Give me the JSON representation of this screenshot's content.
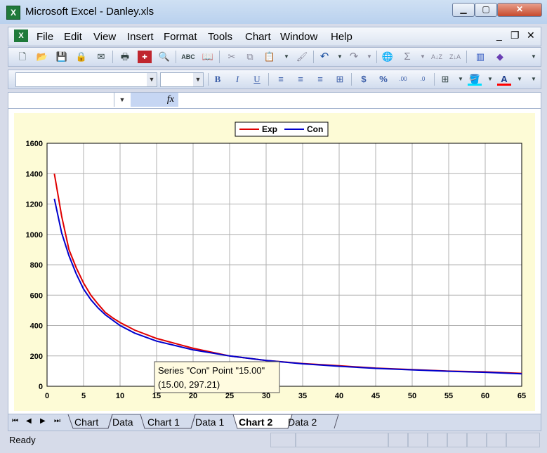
{
  "window": {
    "title": "Microsoft Excel - Danley.xls",
    "app_icon": "excel-icon"
  },
  "menu": [
    "File",
    "Edit",
    "View",
    "Insert",
    "Format",
    "Tools",
    "Chart",
    "Window",
    "Help"
  ],
  "toolbar_std": [
    "new-icon",
    "open-icon",
    "save-icon",
    "permission-icon",
    "email-icon",
    "print-icon",
    "research-icon",
    "print-preview-icon",
    "spelling-icon",
    "research-book-icon",
    "cut-icon",
    "copy-icon",
    "paste-icon",
    "format-painter-icon",
    "undo-icon",
    "redo-icon",
    "hyperlink-icon",
    "autosum-icon",
    "sort-ascending-icon",
    "sort-descending-icon",
    "chart-wizard-icon",
    "drawing-icon"
  ],
  "formatting": {
    "bold": "B",
    "italic": "I",
    "underline": "U",
    "currency": "$",
    "percent": "%"
  },
  "formula": {
    "fx": "fx",
    "name_box": ""
  },
  "chart_data": {
    "type": "line",
    "legend": [
      "Exp",
      "Con"
    ],
    "legend_position": "top-center",
    "x": [
      1,
      2,
      3,
      4,
      5,
      6,
      7,
      8,
      9,
      10,
      12,
      15,
      20,
      25,
      30,
      35,
      40,
      45,
      50,
      55,
      60,
      65
    ],
    "series": [
      {
        "name": "Exp",
        "color": "#e00000",
        "values": [
          1400,
          1120,
          900,
          780,
          680,
          600,
          540,
          485,
          450,
          420,
          370,
          315,
          250,
          200,
          170,
          150,
          135,
          120,
          110,
          100,
          95,
          85
        ]
      },
      {
        "name": "Con",
        "color": "#0000cc",
        "values": [
          1235,
          1010,
          860,
          740,
          640,
          570,
          515,
          470,
          435,
          400,
          350,
          297.21,
          240,
          200,
          170,
          148,
          132,
          118,
          108,
          99,
          92,
          82
        ]
      }
    ],
    "xlim": [
      0,
      65
    ],
    "ylim": [
      0,
      1600
    ],
    "xticks": [
      0,
      5,
      10,
      15,
      20,
      25,
      30,
      35,
      40,
      45,
      50,
      55,
      60,
      65
    ],
    "yticks": [
      0,
      200,
      400,
      600,
      800,
      1000,
      1200,
      1400,
      1600
    ],
    "grid": true,
    "tooltip": {
      "line1": "Series \"Con\" Point \"15.00\"",
      "line2": "(15.00, 297.21)"
    }
  },
  "sheets": [
    "Chart",
    "Data",
    "Chart 1",
    "Data 1",
    "Chart 2",
    "Data 2"
  ],
  "active_sheet": "Chart 2",
  "status": {
    "text": "Ready"
  }
}
